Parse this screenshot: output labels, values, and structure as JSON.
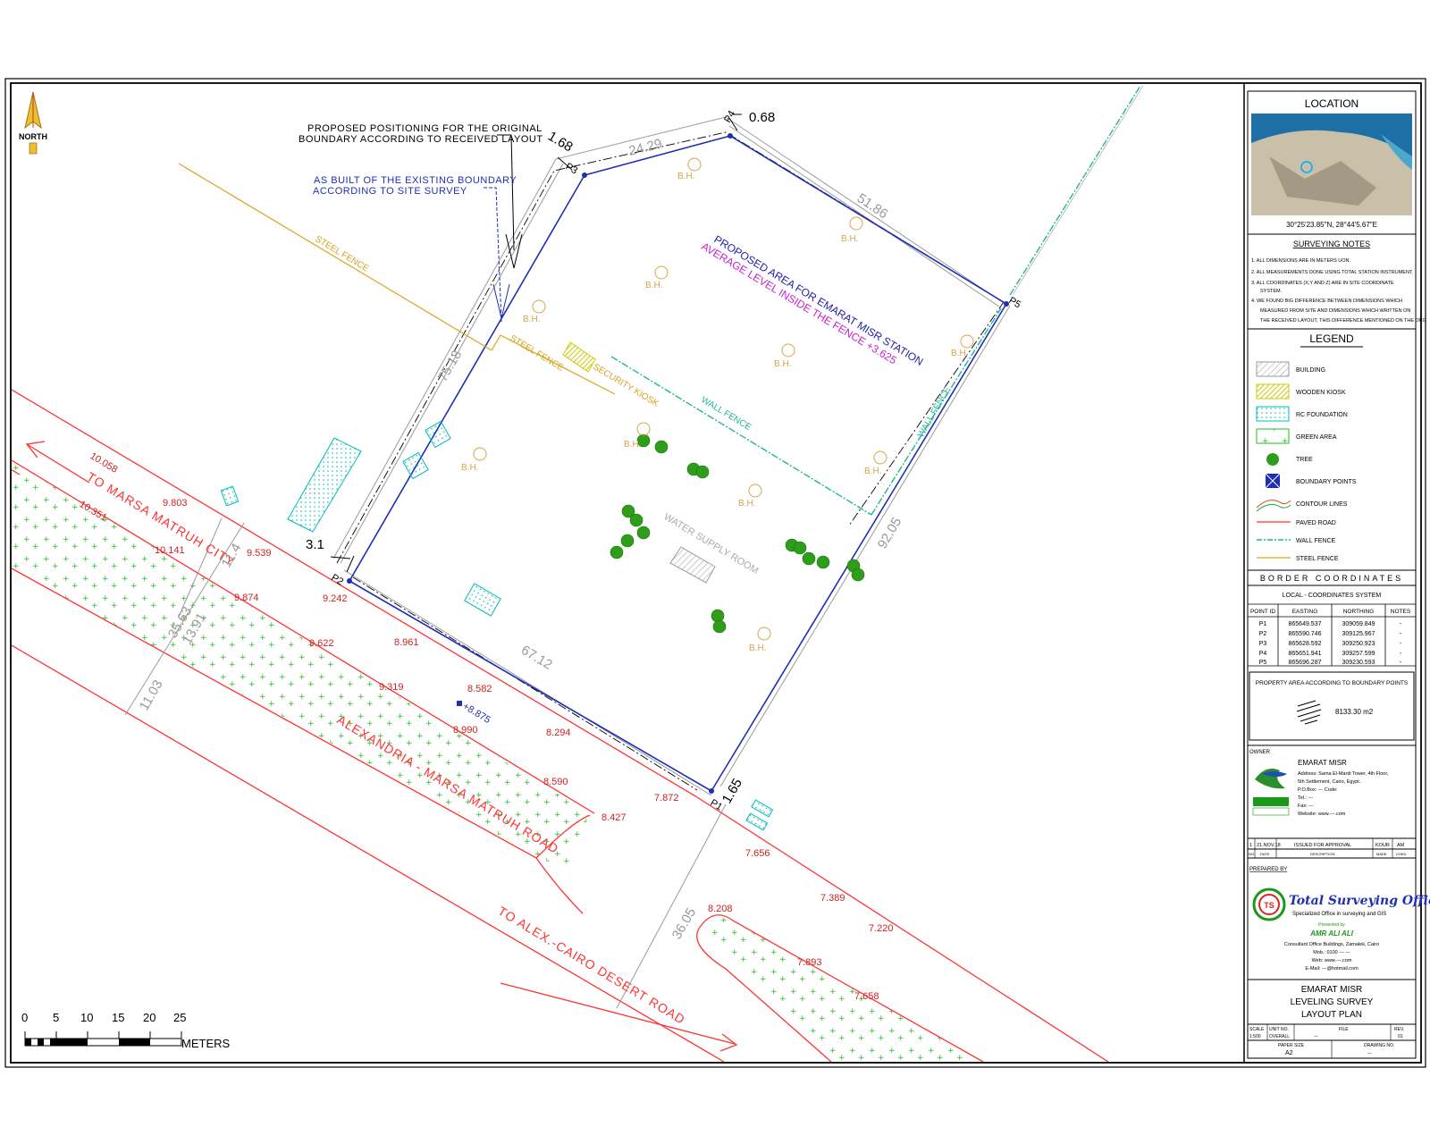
{
  "north": {
    "label": "NORTH"
  },
  "scale_bar": {
    "ticks": [
      "0",
      "5",
      "10",
      "15",
      "20",
      "25"
    ],
    "unit": "METERS"
  },
  "annotations": {
    "proposed_boundary_1": "PROPOSED POSITIONING FOR THE ORIGINAL",
    "proposed_boundary_2": "BOUNDARY ACCORDING TO RECEIVED LAYOUT",
    "as_built_1": "AS BUILT OF THE EXISTING BOUNDARY",
    "as_built_2": "ACCORDING TO SITE SURVEY",
    "proposed_area_1": "PROPOSED AREA FOR EMARAT MISR STATION",
    "proposed_area_2": "AVERAGE LEVEL INSIDE THE FENCE +3.625",
    "steel_fence": "STEEL FENCE",
    "wall_fence": "WALL FENCE",
    "security_kiosk": "SECURITY KIOSK",
    "water_supply_room": "WATER SUPPLY ROOM",
    "bh": "B.H.",
    "to_marsa": "TO MARSA MATRUH CITY",
    "road_name": "ALEXANDRIA - MARSA MATRUH ROAD",
    "to_alex": "TO ALEX.-CAIRO DESERT ROAD"
  },
  "points": {
    "p1": "P1",
    "p2": "P2",
    "p3": "P3",
    "p4": "P4",
    "p5": "P5"
  },
  "dimensions": [
    "24.29",
    "0.68",
    "1.68",
    "51.86",
    "75.18",
    "3.1",
    "67.12",
    "92.05",
    "1.65",
    "36.05",
    "11.03",
    "35.63",
    "13.91",
    "11.4"
  ],
  "levels": [
    "10.058",
    "10.351",
    "9.803",
    "10.141",
    "9.539",
    "9.874",
    "9.242",
    "9.622",
    "8.961",
    "9.319",
    "8.582",
    "+8.875",
    "8.990",
    "8.294",
    "8.590",
    "7.872",
    "8.427",
    "7.656",
    "7.389",
    "7.220",
    "8.208",
    "7.893",
    "7.658"
  ],
  "title_block": {
    "location_title": "LOCATION",
    "coords": "30°25'23.85\"N, 28°44'5.67\"E",
    "notes_title": "SURVEYING NOTES",
    "notes": [
      "1. ALL DIMENSIONS ARE IN METERS UON.",
      "2. ALL MEASUREMENTS DONE USING TOTAL STATION INSTRUMENT.",
      "3. ALL COORDINATES (X,Y AND Z) ARE IN SITE COORDINATE",
      "SYSTEM.",
      "4. WE FOUND BIG DIFFERENCE BETWEEN DIMENSIONS WHICH",
      "MEASURED FROM SITE AND DIMENSIONS WHICH WRITTEN ON",
      "THE RECEIVED LAYOUT, THIS DIFFERENCE MENTIONED ON THE DRG"
    ],
    "legend_title": "LEGEND",
    "legend": [
      "BUILDING",
      "WOODEN KIOSK",
      "RC FOUNDATION",
      "GREEN AREA",
      "TREE",
      "BOUNDARY POINTS",
      "CONTOUR LINES",
      "PAVED ROAD",
      "WALL FENCE",
      "STEEL FENCE"
    ],
    "border_title": "BORDER COORDINATES",
    "border_sub": "LOCAL - COORDINATES SYSTEM",
    "border_headers": [
      "POINT ID",
      "EASTING",
      "NORTHING",
      "NOTES"
    ],
    "border_rows": [
      [
        "P1",
        "865649.537",
        "309059.849",
        "-"
      ],
      [
        "P2",
        "865590.746",
        "309125.967",
        "-"
      ],
      [
        "P3",
        "865628.592",
        "309250.923",
        "-"
      ],
      [
        "P4",
        "865651.941",
        "309257.599",
        "-"
      ],
      [
        "P5",
        "865696.287",
        "309230.593",
        "-"
      ]
    ],
    "area_title": "PROPERTY AREA ACCORDING TO BOUNDARY POINTS",
    "area_value": "8133.30 m2",
    "owner_label": "OWNER",
    "owner_name": "EMARAT MISR",
    "owner_lines": [
      "Address: Sama El-Mardi Tower, 4th Floor,",
      "5th Settlement, Cairo, Egypt.",
      "P.O.Box: ---  Code:",
      "Tel.: ---",
      "Fax: ---",
      "Website: www.---.com"
    ],
    "rev_row": [
      "1",
      "21.NOV.18",
      "ISSUED FOR APPROVAL",
      "KOUR",
      "AM"
    ],
    "rev_head": [
      "NO.",
      "DATE",
      "DESCRIPTION",
      "MADE",
      "CHKD"
    ],
    "prepared_by": "PREPARED BY",
    "company": "Total Surveying Office",
    "company_tag": "Specialized Office in surveying and GIS",
    "engineer_prefix": "Presented by",
    "engineer": "AMR ALI ALI",
    "company_lines": [
      "Consultant Office Buildings, Zamalek, Cairo",
      "Mob.: 0100 --- ---",
      "Web: www.---.com",
      "E-Mail: ---@hotmail.com"
    ],
    "project_1": "EMARAT MISR",
    "project_2": "LEVELING SURVEY",
    "project_3": "LAYOUT PLAN",
    "meta_headers": [
      "SCALE",
      "UNIT NO.",
      "FILE",
      "REV."
    ],
    "meta_values": [
      "1:500",
      "OVERALL",
      "---",
      "01"
    ],
    "meta_headers2": [
      "PAPER SIZE",
      "DRAWING NO."
    ],
    "meta_values2": [
      "A2",
      "---"
    ]
  }
}
